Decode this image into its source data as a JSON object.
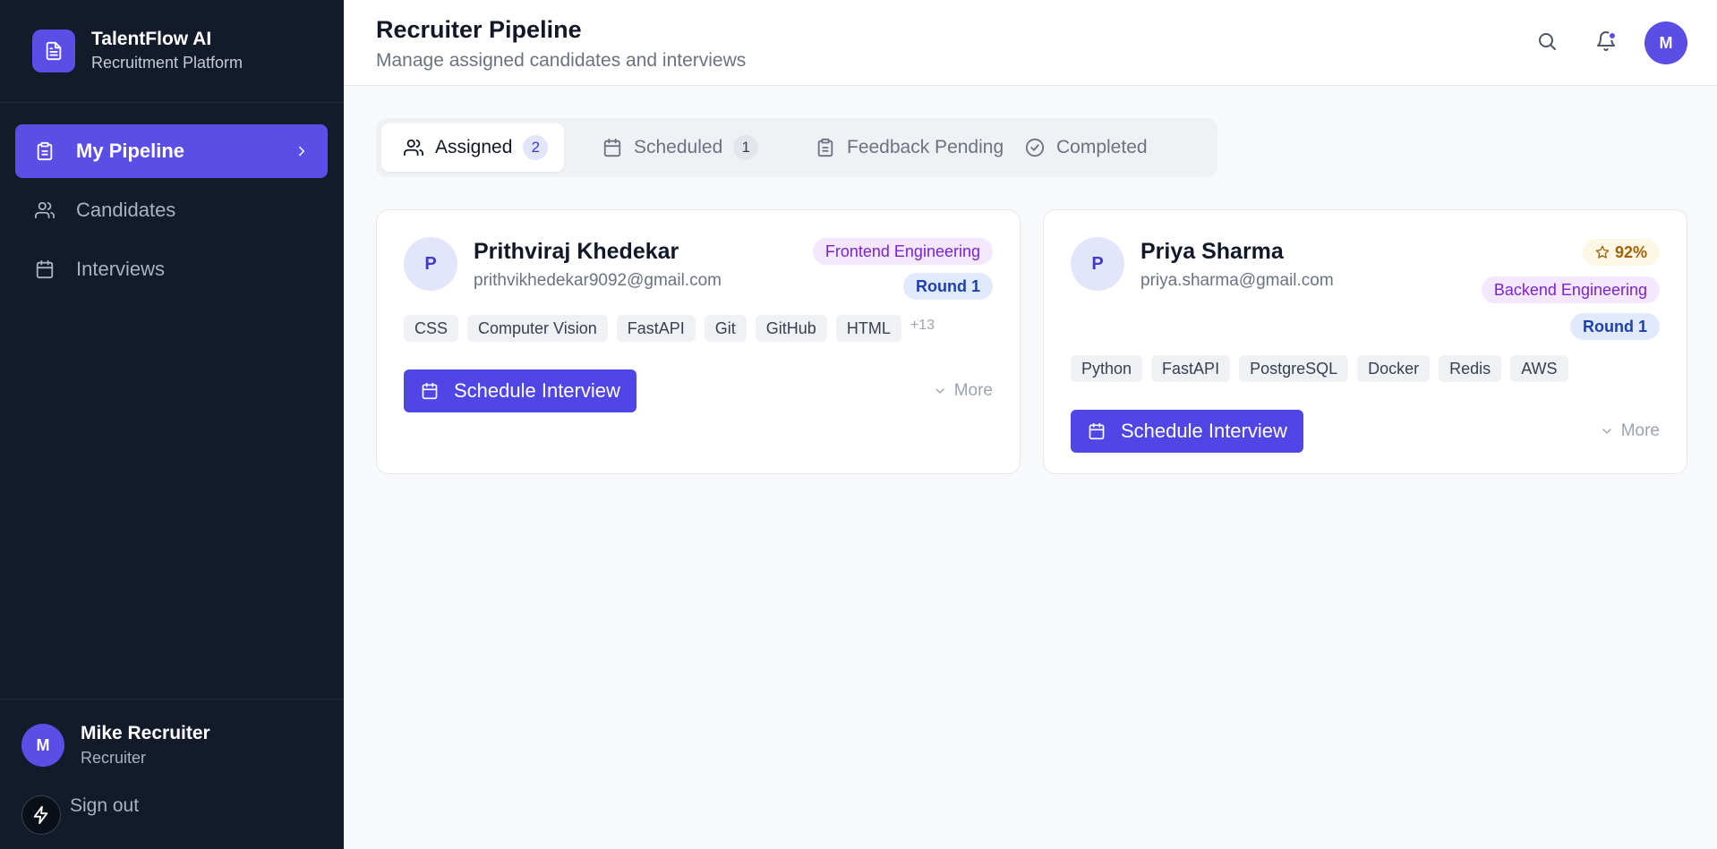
{
  "brand": {
    "name": "TalentFlow AI",
    "subtitle": "Recruitment Platform"
  },
  "sidebar": {
    "items": [
      {
        "label": "My Pipeline",
        "icon": "clipboard-icon",
        "active": true
      },
      {
        "label": "Candidates",
        "icon": "users-icon",
        "active": false
      },
      {
        "label": "Interviews",
        "icon": "calendar-icon",
        "active": false
      }
    ]
  },
  "user": {
    "initial": "M",
    "name": "Mike Recruiter",
    "role": "Recruiter",
    "signout_label": "Sign out"
  },
  "header": {
    "title": "Recruiter Pipeline",
    "subtitle": "Manage assigned candidates and interviews",
    "avatar_initial": "M"
  },
  "tabs": [
    {
      "label": "Assigned",
      "count": "2",
      "icon": "users-icon",
      "active": true
    },
    {
      "label": "Scheduled",
      "count": "1",
      "icon": "calendar-icon",
      "active": false
    },
    {
      "label": "Feedback Pending",
      "count": null,
      "icon": "clipboard-icon",
      "active": false
    },
    {
      "label": "Completed",
      "count": null,
      "icon": "check-circle-icon",
      "active": false
    }
  ],
  "candidates": [
    {
      "initial": "P",
      "name": "Prithviraj Khedekar",
      "email": "prithvikhedekar9092@gmail.com",
      "department": "Frontend Engineering",
      "round": "Round 1",
      "score": null,
      "skills": [
        "CSS",
        "Computer Vision",
        "FastAPI",
        "Git",
        "GitHub",
        "HTML"
      ],
      "more_skills": "+13",
      "action_label": "Schedule Interview",
      "more_label": "More"
    },
    {
      "initial": "P",
      "name": "Priya Sharma",
      "email": "priya.sharma@gmail.com",
      "department": "Backend Engineering",
      "round": "Round 1",
      "score": "92%",
      "skills": [
        "Python",
        "FastAPI",
        "PostgreSQL",
        "Docker",
        "Redis",
        "AWS"
      ],
      "more_skills": null,
      "action_label": "Schedule Interview",
      "more_label": "More"
    }
  ],
  "colors": {
    "accent": "#5b4ee6",
    "sidebar_bg": "#131a2a",
    "page_bg": "#f8f9fb"
  }
}
